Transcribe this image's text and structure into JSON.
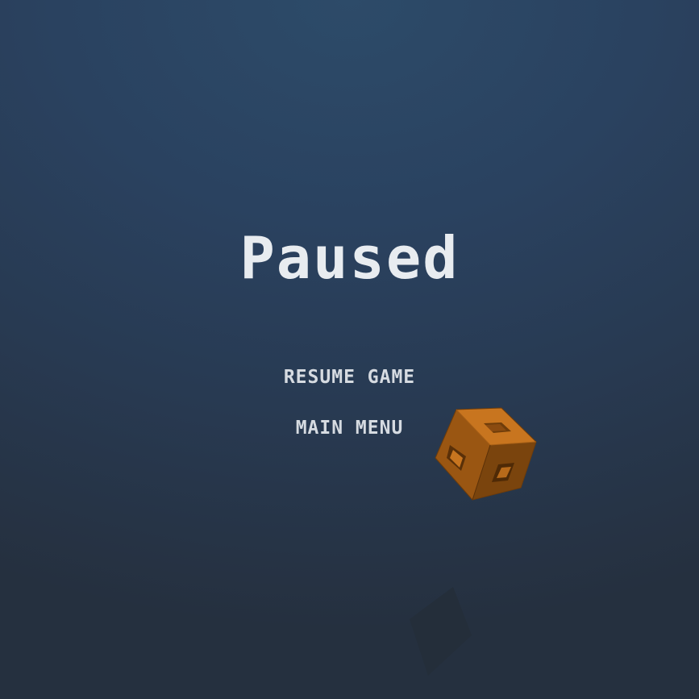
{
  "pause_menu": {
    "title": "Paused",
    "resume_label": "RESUME GAME",
    "main_menu_label": "MAIN MENU"
  },
  "scene": {
    "object": "wooden-crate-icon",
    "shadow": "crate-shadow",
    "colors": {
      "background_top": "#2d4b69",
      "background_bottom": "#25303f",
      "title_text": "#e8ecf0",
      "button_text": "#d6dbe1",
      "crate_top": "#c8751f",
      "crate_left": "#9a5612",
      "crate_right": "#7a440d"
    }
  }
}
